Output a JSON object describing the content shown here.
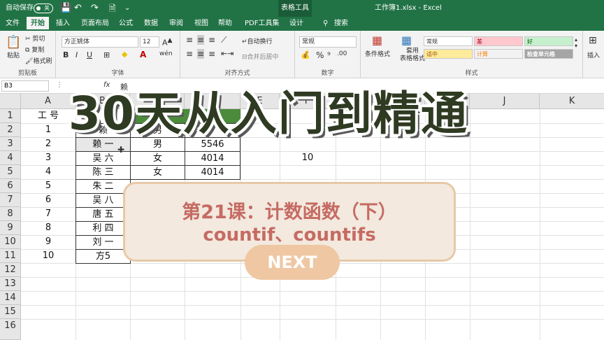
{
  "titlebar": {
    "autosave": "自动保存",
    "toggle_state": "关",
    "context_tab": "表格工具",
    "filename": "工作簿1.xlsx  -  Excel"
  },
  "tabs": [
    "文件",
    "开始",
    "插入",
    "页面布局",
    "公式",
    "数据",
    "审阅",
    "视图",
    "帮助",
    "PDF工具集",
    "设计",
    "搜索"
  ],
  "ribbon": {
    "clipboard": {
      "paste": "粘贴",
      "cut": "剪切",
      "copy": "复制",
      "format_painter": "格式刷",
      "label": "剪贴板"
    },
    "font": {
      "name": "方正姚体",
      "size": "12",
      "bold": "B",
      "italic": "I",
      "underline": "U",
      "label": "字体"
    },
    "alignment": {
      "wrap": "自动换行",
      "merge": "合并后居中",
      "label": "对齐方式"
    },
    "number": {
      "format": "常规",
      "label": "数字"
    },
    "styles": {
      "conditional": "条件格式",
      "table": "套用\n表格格式",
      "cells": [
        "常规",
        "差",
        "好",
        "适中",
        "计算",
        "检查单元格"
      ],
      "label": "样式"
    },
    "insert": "插入"
  },
  "formula_bar": {
    "name_box": "B3",
    "fx": "fx",
    "content": "赖"
  },
  "columns": [
    "A",
    "B",
    "C",
    "D",
    "E",
    "F",
    "G",
    "H",
    "I",
    "J",
    "K"
  ],
  "rows": [
    "1",
    "2",
    "3",
    "4",
    "5",
    "6",
    "7",
    "8",
    "9",
    "10",
    "11",
    "12",
    "13",
    "14",
    "15",
    "16"
  ],
  "cells": {
    "a": [
      "工 号",
      "1",
      "2",
      "3",
      "4",
      "5",
      "6",
      "7",
      "8",
      "9",
      "10"
    ],
    "b": [
      "",
      "赖",
      "赖 一",
      "吴 六",
      "陈 三",
      "朱 二",
      "吴 八",
      "唐 五",
      "利 四",
      "刘 一",
      "方5"
    ],
    "c": [
      "",
      "男",
      "男",
      "女",
      "女"
    ],
    "d": [
      "",
      "",
      "5546",
      "4014",
      "4014"
    ],
    "f4": "10"
  },
  "overlay": {
    "title": "30天从入门到精通",
    "lesson": "第21课：计数函数（下）",
    "functions": "countif、countifs",
    "next": "NEXT"
  },
  "colors": {
    "excel_green": "#217346",
    "card_bg": "#f3e9de",
    "card_text": "#c56b63",
    "next_bg": "#efc7a3"
  }
}
